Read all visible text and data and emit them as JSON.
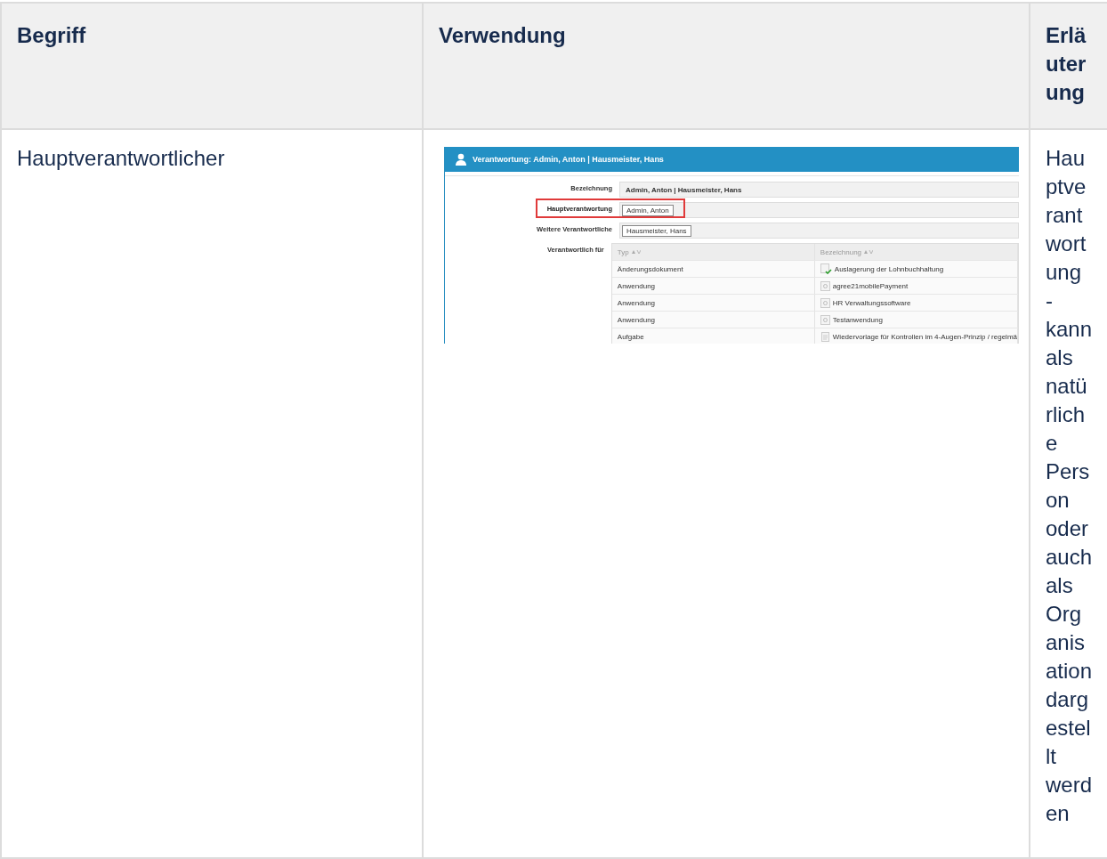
{
  "table": {
    "columns": [
      "Begriff",
      "Verwendung",
      "Erläuterung"
    ],
    "rows": [
      {
        "term": "Hauptverantwortlicher",
        "explanation": "Hauptverantwortung - kann als natürliche Person oder auch als Organisation dargestellt werden",
        "screenshot": {
          "title": "Verantwortung: Admin, Anton | Hausmeister, Hans",
          "fields": [
            {
              "label": "Bezeichnung",
              "value": "Admin, Anton | Hausmeister, Hans",
              "kind": "text",
              "highlighted": false
            },
            {
              "label": "Hauptverantwortung",
              "value": "Admin, Anton",
              "kind": "tag",
              "highlighted": true
            },
            {
              "label": "Weitere Verantwortliche",
              "value": "Hausmeister, Hans",
              "kind": "tag",
              "highlighted": false
            }
          ],
          "list_label": "Verantwortlich für",
          "list_columns": [
            "Typ",
            "Bezeichnung"
          ],
          "list_rows": [
            {
              "typ": "Änderungsdokument",
              "name": "Auslagerung der Lohnbuchhaltung",
              "kind": "document-check"
            },
            {
              "typ": "Anwendung",
              "name": "agree21mobilePayment",
              "kind": "app"
            },
            {
              "typ": "Anwendung",
              "name": "HR Verwaltungssoftware",
              "kind": "app"
            },
            {
              "typ": "Anwendung",
              "name": "Testanwendung",
              "kind": "app"
            },
            {
              "typ": "Aufgabe",
              "name": "Wiedervorlage für Kontrollen im 4-Augen-Prinzip / regelmä",
              "kind": "task"
            }
          ]
        }
      }
    ]
  }
}
